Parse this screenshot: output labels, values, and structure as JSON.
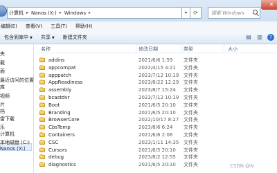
{
  "address": {
    "crumbs": [
      "计算机",
      "Nanos (X:)",
      "Windows"
    ],
    "separator": "▸",
    "dropdown_glyph": "▾",
    "refresh_glyph": "⟳"
  },
  "search": {
    "placeholder": "搜索 Windows"
  },
  "window": {
    "close_glyph": "✕"
  },
  "menu": {
    "items": [
      "编辑(E)",
      "查看(V)",
      "工具(T)",
      "帮助(H)"
    ]
  },
  "toolbar": {
    "include_label": "包含到库中",
    "share_label": "共享",
    "new_folder_label": "新建文件夹",
    "caret": "▼",
    "views_icon_glyph": "▤",
    "pane_icon_glyph": "▥",
    "help_icon_glyph": "?"
  },
  "columns": {
    "name": "名称",
    "date": "修改日期",
    "type": "类型",
    "size": "大小"
  },
  "sidebar": {
    "items": [
      "夹",
      "",
      "载",
      "面",
      "最近访问的位置",
      "",
      "",
      "库",
      "",
      "视频",
      "",
      "片",
      "档",
      "",
      "雷下载",
      "乐",
      "",
      "",
      "",
      "计算机",
      "",
      "",
      "",
      "本地磁盘 (C:)",
      "",
      "Nanos (X:)"
    ]
  },
  "files": [
    {
      "name": "addins",
      "date": "2021/6/6 1:59",
      "type": "文件夹"
    },
    {
      "name": "appcompat",
      "date": "2022/4/15 4:21",
      "type": "文件夹"
    },
    {
      "name": "apppatch",
      "date": "2023/7/12 10:19",
      "type": "文件夹"
    },
    {
      "name": "AppReadiness",
      "date": "2023/8/22 12:29",
      "type": "文件夹"
    },
    {
      "name": "assembly",
      "date": "2023/8/7 15:24",
      "type": "文件夹"
    },
    {
      "name": "bcastdvr",
      "date": "2023/7/12 10:19",
      "type": "文件夹"
    },
    {
      "name": "Boot",
      "date": "2021/6/5 20:10",
      "type": "文件夹"
    },
    {
      "name": "Branding",
      "date": "2021/6/5 20:10",
      "type": "文件夹"
    },
    {
      "name": "BrowserCore",
      "date": "2022/10/17 8:27",
      "type": "文件夹"
    },
    {
      "name": "CbsTemp",
      "date": "2023/8/6 6:24",
      "type": "文件夹"
    },
    {
      "name": "Containers",
      "date": "2021/6/6 2:06",
      "type": "文件夹"
    },
    {
      "name": "CSC",
      "date": "2023/1/11 14:35",
      "type": "文件夹"
    },
    {
      "name": "Cursors",
      "date": "2021/6/5 20:10",
      "type": "文件夹"
    },
    {
      "name": "debug",
      "date": "2023/8/2 12:55",
      "type": "文件夹"
    },
    {
      "name": "diagnostics",
      "date": "2021/6/5 20:10",
      "type": "文件夹"
    }
  ],
  "watermark": "CSDN @N"
}
